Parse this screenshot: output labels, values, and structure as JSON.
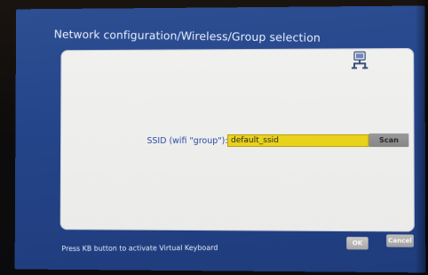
{
  "window": {
    "title": "Network configuration/Wireless/Group selection"
  },
  "panel": {
    "icon": "network-computer-icon",
    "ssid_label": "SSID (wifi \"group\"):",
    "ssid_value": "default_ssid",
    "scan_label": "Scan"
  },
  "footer": {
    "hint": "Press KB button to activate Virtual Keyboard",
    "ok_label": "OK",
    "cancel_label": "Cancel"
  },
  "colors": {
    "screen_bg": "#2a4a8e",
    "panel_bg": "#ececea",
    "input_highlight": "#e9d21a",
    "label_text": "#2a4aa6"
  }
}
